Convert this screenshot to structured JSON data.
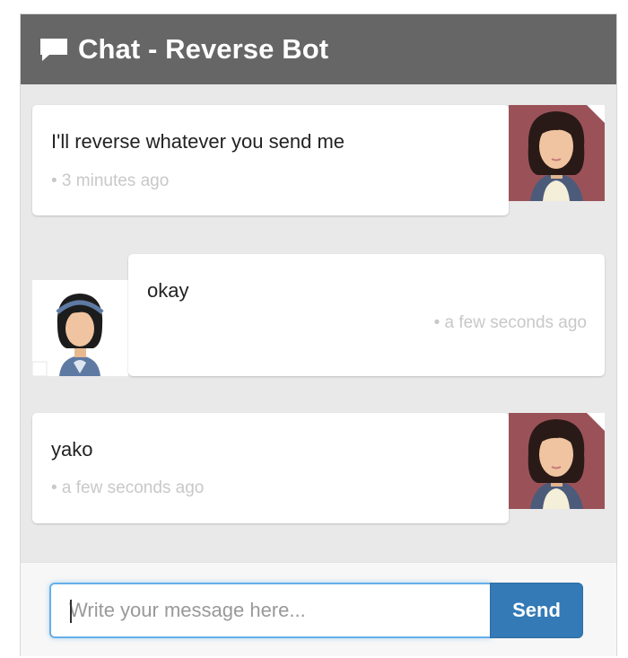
{
  "header": {
    "icon": "chat-bubble-icon",
    "title": "Chat - Reverse Bot"
  },
  "messages": [
    {
      "sender": "bot",
      "avatar": "female-avatar-icon",
      "text": "I'll reverse whatever you send me",
      "time": "• 3 minutes ago"
    },
    {
      "sender": "user",
      "avatar": "user-avatar-icon",
      "text": "okay",
      "time": "• a few seconds ago"
    },
    {
      "sender": "bot",
      "avatar": "female-avatar-icon",
      "text": "yako",
      "time": "• a few seconds ago"
    }
  ],
  "composer": {
    "placeholder": "Write your message here...",
    "value": "",
    "send_label": "Send"
  },
  "colors": {
    "header_bg": "#666666",
    "panel_bg": "#e9e9e9",
    "bot_avatar_bg": "#9a5258",
    "send_button": "#337ab7",
    "input_focus": "#66afe9"
  }
}
